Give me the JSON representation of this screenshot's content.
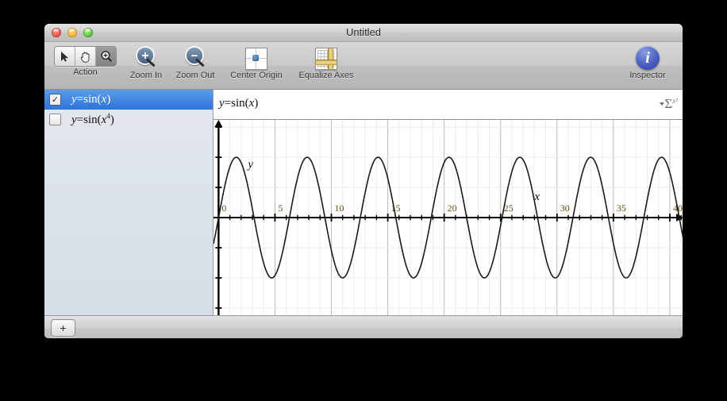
{
  "window": {
    "title": "Untitled"
  },
  "traffic": {
    "close": "close-button",
    "minimize": "minimize-button",
    "zoom": "zoom-button"
  },
  "toolbar": {
    "action_label": "Action",
    "zoom_in_label": "Zoom In",
    "zoom_out_label": "Zoom Out",
    "center_origin_label": "Center Origin",
    "equalize_axes_label": "Equalize Axes",
    "inspector_label": "Inspector",
    "zoom_in_glyph": "+",
    "zoom_out_glyph": "−",
    "inspector_glyph": "i",
    "segments": [
      {
        "name": "arrow-tool",
        "glyph": "➤",
        "selected": false
      },
      {
        "name": "hand-tool",
        "glyph": "✋",
        "selected": false
      },
      {
        "name": "zoom-tool",
        "glyph": "⊕",
        "selected": true
      }
    ]
  },
  "sidebar": {
    "items": [
      {
        "label_html": "y=sin(x)",
        "checked": true,
        "selected": true
      },
      {
        "label_html": "y=sin(x^4)",
        "checked": false,
        "selected": false
      }
    ],
    "add_button_label": "+"
  },
  "formula_bar": {
    "text": "y=sin(x)",
    "symbol_button": {
      "sigma": "Σ",
      "superscript": "x²"
    }
  },
  "chart_data": {
    "type": "line",
    "title": "y=sin(x)",
    "xlabel": "x",
    "ylabel": "y",
    "expression": "y=sin(x)",
    "xlim": [
      -0.45,
      41.2
    ],
    "ylim": [
      -1.62,
      1.62
    ],
    "x_ticks_major": [
      0,
      5,
      10,
      15,
      20,
      25,
      30,
      35,
      40
    ],
    "x_tick_labels": [
      "0",
      "5",
      "10",
      "15",
      "20",
      "25",
      "30",
      "35",
      "40"
    ],
    "x_minor_step": 1,
    "y_ticks_major": [
      -1.5,
      -1.0,
      -0.5,
      0.5,
      1.0,
      1.5
    ],
    "y_minor_step": 0.5,
    "grid": true,
    "grid_minor_color": "#ebebeb",
    "grid_major_color": "#b9b9b9",
    "axis_color": "#000000",
    "curve_color": "#1a1a1a",
    "curve_width": 1.6,
    "amplitude": 1,
    "period": 6.2832,
    "x_axis_label_pos": 28,
    "y_axis_label_pos": 2.6,
    "tick_label_color": "#6b4a12"
  }
}
